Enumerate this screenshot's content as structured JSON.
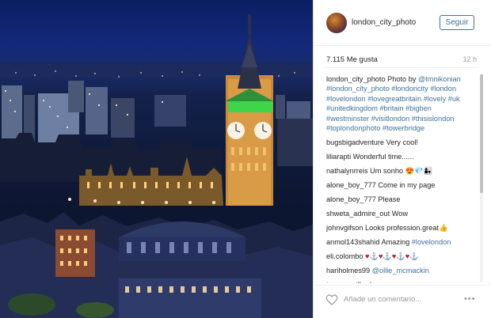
{
  "post": {
    "username": "london_city_photo",
    "follow_label": "Seguir",
    "likes": "7.115 Me gusta",
    "time": "12 h"
  },
  "caption": {
    "username": "london_city_photo",
    "text": "Photo by",
    "mention": "@tmnikonian",
    "hashtags": [
      "#london_city_photo",
      "#londoncity",
      "#london",
      "#lovelondon",
      "#lovegreatbritain",
      "#lovely",
      "#uk",
      "#unitedkingdom",
      "#britain",
      "#bigben",
      "#westminster",
      "#visitlondon",
      "#thisislondon",
      "#toplondonphoto",
      "#towerbridge"
    ]
  },
  "comments": [
    {
      "user": "bugsbigadventure",
      "text": "Very cool!"
    },
    {
      "user": "liliarapti",
      "text": "Wonderful time......"
    },
    {
      "user": "nathalynrreis",
      "text": "Um sonho 😍💎👩‍👧"
    },
    {
      "user": "alone_boy_777",
      "text": "Come in my page"
    },
    {
      "user": "alone_boy_777",
      "text": "Please"
    },
    {
      "user": "shweta_admire_out",
      "text": "Wow"
    },
    {
      "user": "johnvgifson",
      "text": "Looks profession.great👍"
    },
    {
      "user": "anmol143shahid",
      "text": "Amazing",
      "tag": "#lovelondon"
    },
    {
      "user": "eli.colombo",
      "text": "♥⚓♥⚓♥⚓♥⚓"
    },
    {
      "user": "hariholmes99",
      "text": "",
      "tag": "@ollie_mcmackin"
    },
    {
      "user": "jammrsmillard",
      "text": "♥♥♥"
    }
  ],
  "footer": {
    "comment_placeholder": "Añade un comentario...",
    "more_label": "•••"
  },
  "icons": {
    "like": "heart-outline-icon",
    "more": "ellipsis-icon"
  },
  "colors": {
    "link": "#3f729b",
    "tower_light": "#e6a24a",
    "tower_green": "#3fd54a"
  }
}
